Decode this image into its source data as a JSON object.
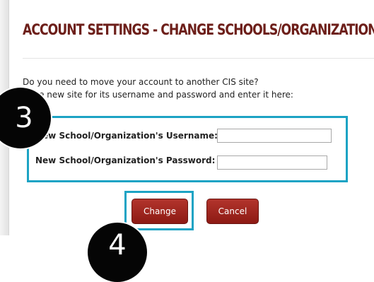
{
  "page": {
    "title": "ACCOUNT SETTINGS - CHANGE SCHOOLS/ORGANIZATIONS",
    "desc_line1": "Do you need to move your account to another CIS site?",
    "desc_line2": "k the new site for its username and password and enter it here:"
  },
  "form": {
    "username_label": "New School/Organization's Username:",
    "username_value": "",
    "password_label": "New School/Organization's Password:",
    "password_value": ""
  },
  "buttons": {
    "change_label": "Change",
    "cancel_label": "Cancel"
  },
  "annotations": {
    "step3": "3",
    "step4": "4",
    "highlight_color": "#1ca3c4"
  },
  "colors": {
    "title": "#6d1f1a",
    "button": "#a3281f"
  }
}
